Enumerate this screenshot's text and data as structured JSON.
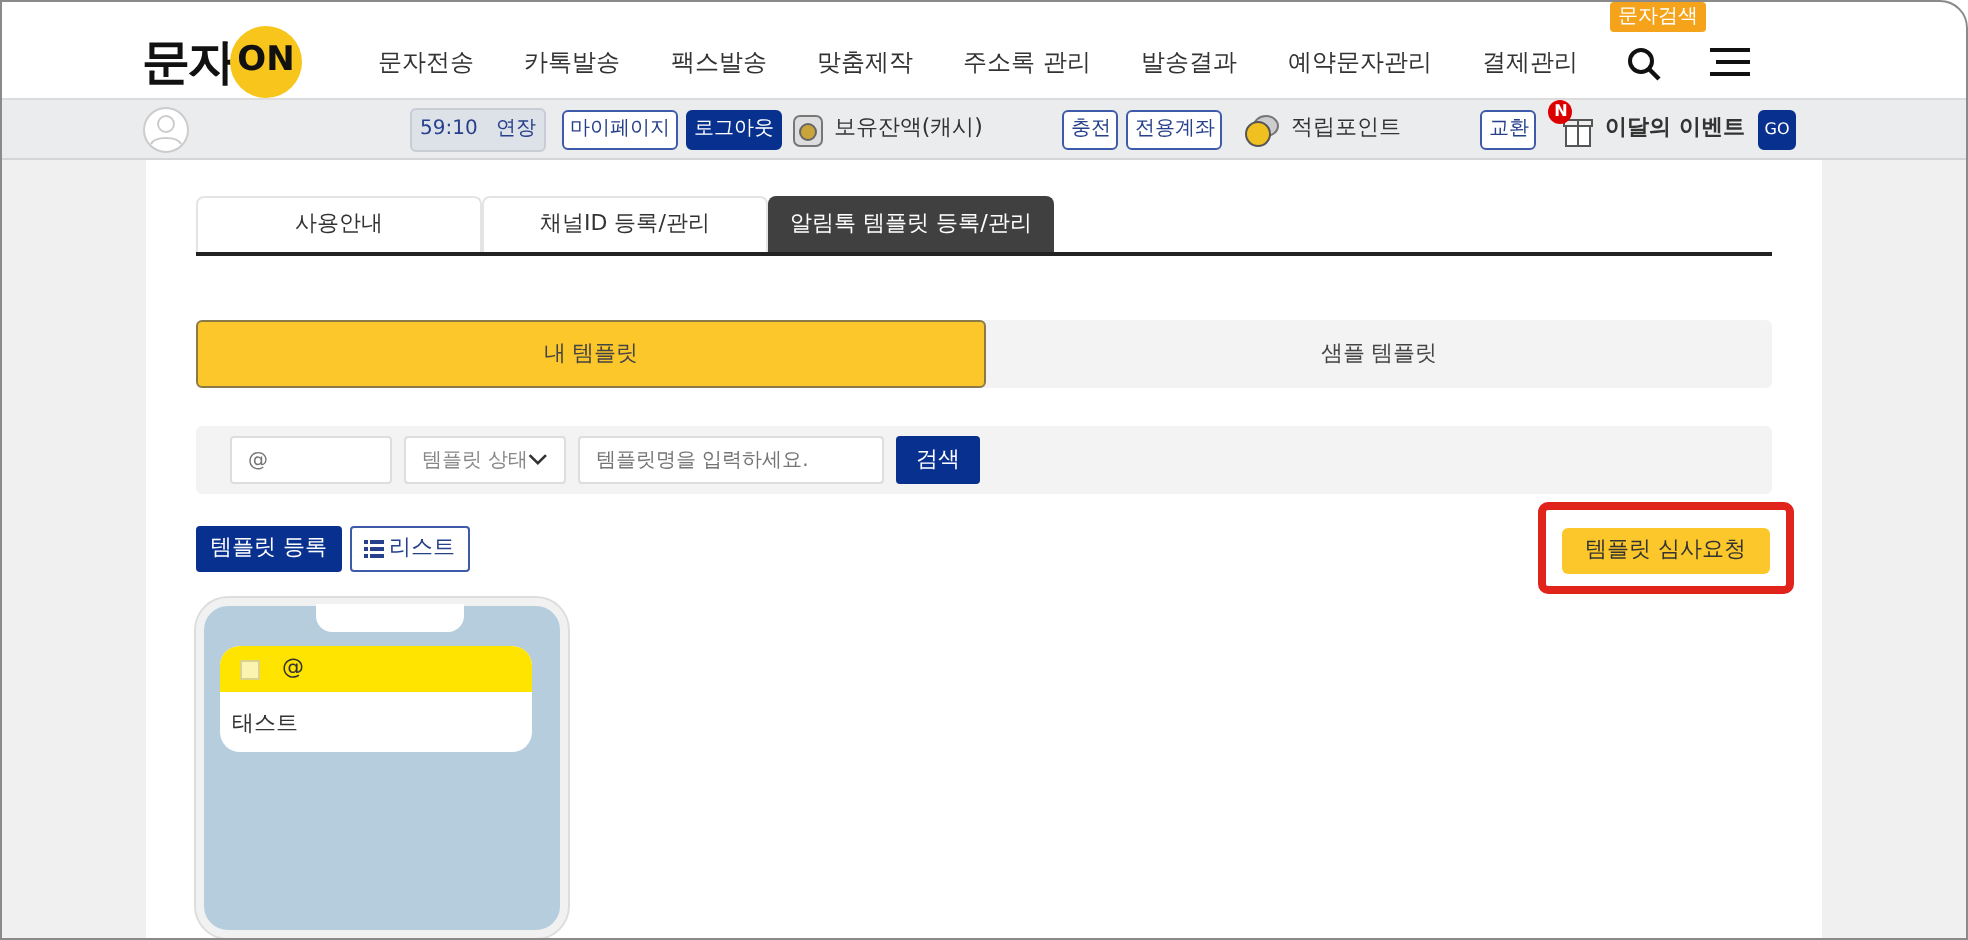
{
  "logo": {
    "text": "문자",
    "badge": "ON"
  },
  "nav": [
    "문자전송",
    "카톡발송",
    "팩스발송",
    "맞춤제작",
    "주소록 관리",
    "발송결과",
    "예약문자관리",
    "결제관리"
  ],
  "search_tag": "문자검색",
  "subbar": {
    "timer": "59:10",
    "extend": "연장",
    "mypage": "마이페이지",
    "logout": "로그아웃",
    "balance": "보유잔액(캐시)",
    "charge": "충전",
    "account": "전용계좌",
    "points": "적립포인트",
    "exchange": "교환",
    "event_new": "N",
    "event": "이달의 이벤트",
    "go": "GO"
  },
  "tabs": [
    {
      "label": "사용안내",
      "selected": false
    },
    {
      "label": "채널ID 등록/관리",
      "selected": false
    },
    {
      "label": "알림톡 템플릿 등록/관리",
      "selected": true
    }
  ],
  "segments": [
    {
      "label": "내 템플릿",
      "selected": true
    },
    {
      "label": "샘플 템플릿",
      "selected": false
    }
  ],
  "filter": {
    "sender_placeholder": "@",
    "status": "템플릿 상태",
    "name_placeholder": "템플릿명을 입력하세요.",
    "search": "검색"
  },
  "actions": {
    "register": "템플릿 등록",
    "list": "리스트",
    "review": "템플릿 심사요청",
    "review_highlighted": true
  },
  "preview": {
    "checked": false,
    "sender": "@",
    "body": "태스트"
  }
}
